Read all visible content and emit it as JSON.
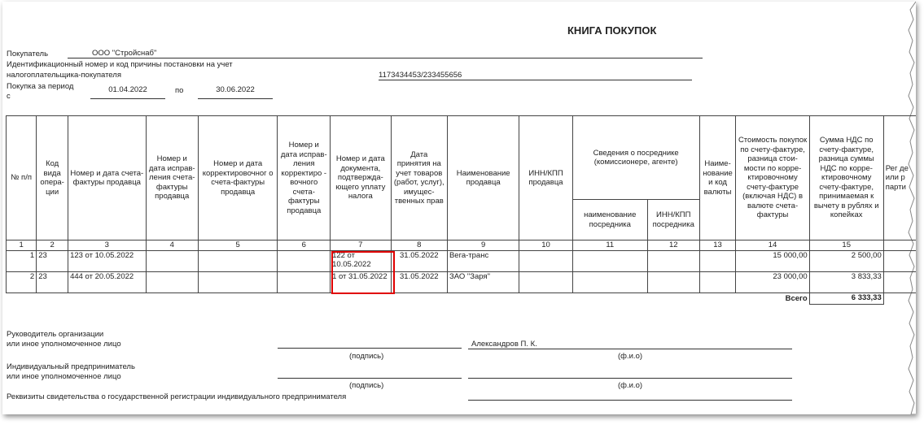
{
  "title": "КНИГА ПОКУПОК",
  "header": {
    "buyer_label": "Покупатель",
    "buyer_value": "ООО \"Стройснаб\"",
    "inn_label_1": "Идентификационный номер и код причины постановки на учет",
    "inn_label_2": "налогоплательщика-покупателя",
    "inn_value": "1173434453/233455656",
    "period_label_1": "Покупка за период",
    "period_label_2": "с",
    "period_from": "01.04.2022",
    "period_to_label": "по",
    "period_to": "30.06.2022"
  },
  "table": {
    "headers": {
      "c1": "№ п/п",
      "c2": "Код вида опера- ции",
      "c3": "Номер и дата счета-фактуры продавца",
      "c4": "Номер и дата исправ- ления счета- фактуры продавца",
      "c5": "Номер и дата корректировочног о счета-фактуры продавца",
      "c6": "Номер и дата исправ- ления корректиро - вочного счета- фактуры продавца",
      "c7": "Номер и дата документа, подтвержда- ющего уплату налога",
      "c8": "Дата принятия на учет товаров (работ, услуг), имущес- твенных прав",
      "c9": "Наименование продавца",
      "c10": "ИНН/КПП продавца",
      "c11_12": "Сведения о посреднике (комиссионере, агенте)",
      "c11": "наименование посредника",
      "c12": "ИНН/КПП посредника",
      "c13": "Наиме- нование и код валюты",
      "c14": "Стоимость покупок по счету-фактуре, разница стои- мости по корре- ктировочному счету-фактуре (включая НДС) в валюте счета-фактуры",
      "c15": "Сумма НДС по счету-фактуре, разница суммы НДС по корре- ктировочному счету-фактуре, принимаемая к вычету в рублях и копейках",
      "c16": "Рег де или р парти"
    },
    "column_numbers": [
      "1",
      "2",
      "3",
      "4",
      "5",
      "6",
      "7",
      "8",
      "9",
      "10",
      "11",
      "12",
      "13",
      "14",
      "15"
    ],
    "rows": [
      {
        "n": "1",
        "code": "23",
        "invoice": "123 от 10.05.2022",
        "doc": "122 от 10.05.2022",
        "date": "31.05.2022",
        "seller": "Вега-транс",
        "cost": "15 000,00",
        "vat": "2 500,00"
      },
      {
        "n": "2",
        "code": "23",
        "invoice": "444 от 20.05.2022",
        "doc": "1 от 31.05.2022",
        "date": "31.05.2022",
        "seller": "ЗАО \"Заря\"",
        "cost": "23 000,00",
        "vat": "3 833,33"
      }
    ],
    "total_label": "Всего",
    "total_value": "6 333,33"
  },
  "footer": {
    "head_label_1": "Руководитель организации",
    "head_label_2": "или иное уполномоченное лицо",
    "head_name": "Александров П. К.",
    "signature_caption": "(подпись)",
    "fio_caption": "(ф.и.о)",
    "ip_label_1": "Индивидуальный предприниматель",
    "ip_label_2": "или иное уполномоченное лицо",
    "ip_signature_caption": "(подпись)",
    "ip_fio_caption": "(ф.и.о)",
    "requisites_label": "Реквизиты свидетельства о государственной регистрации индивидуального предпринимателя"
  },
  "colors": {
    "highlight": "#e00000"
  }
}
